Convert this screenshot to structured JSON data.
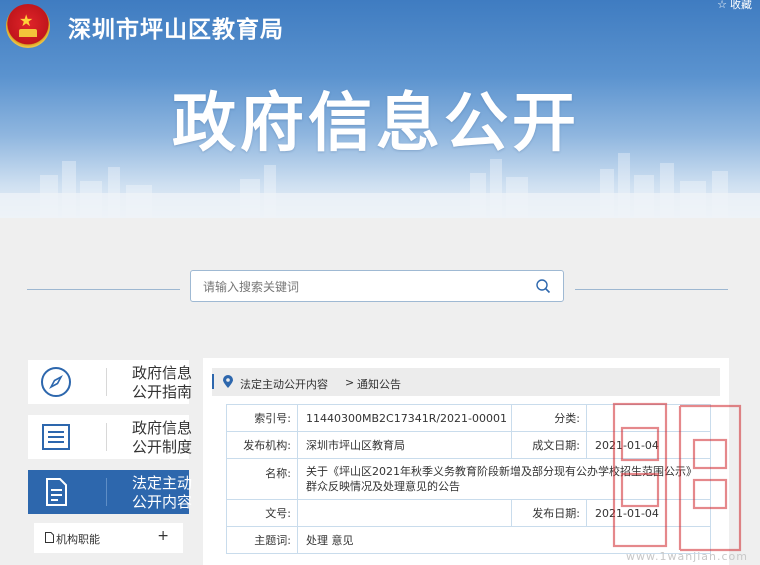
{
  "header": {
    "site_title": "深圳市坪山区教育局",
    "favorite_label": "收藏",
    "banner_title": "政府信息公开"
  },
  "search": {
    "placeholder": "请输入搜索关键词"
  },
  "sidebar": {
    "items": [
      {
        "line1": "政府信息",
        "line2": "公开指南",
        "icon": "compass-icon",
        "active": false
      },
      {
        "line1": "政府信息",
        "line2": "公开制度",
        "icon": "list-document-icon",
        "active": false
      },
      {
        "line1": "法定主动",
        "line2": "公开内容",
        "icon": "document-icon",
        "active": true
      }
    ],
    "sub_items": [
      {
        "label": "机构职能",
        "icon": "document-icon",
        "expand": "+"
      }
    ]
  },
  "breadcrumb": {
    "items": [
      "法定主动公开内容",
      "通知公告"
    ],
    "separator": ">"
  },
  "meta": {
    "index_no_label": "索引号:",
    "index_no": "11440300MB2C17341R/2021-00001",
    "category_label": "分类:",
    "category": "",
    "publisher_label": "发布机构:",
    "publisher": "深圳市坪山区教育局",
    "created_date_label": "成文日期:",
    "created_date": "2021-01-04",
    "name_label": "名称:",
    "name_line1": "关于《坪山区2021年秋季义务教育阶段新增及部分现有公办学校招生范围公示》",
    "name_line2": "群众反映情况及处理意见的公告",
    "doc_no_label": "文号:",
    "doc_no": "",
    "publish_date_label": "发布日期:",
    "publish_date": "2021-01-04",
    "keywords_label": "主题词:",
    "keywords": "处理 意见"
  },
  "watermark": {
    "text": "www.1wanjian.com"
  },
  "colors": {
    "brand_blue": "#2d67ad",
    "table_border": "#c9dcec",
    "watermark_red": "#d0282e"
  }
}
